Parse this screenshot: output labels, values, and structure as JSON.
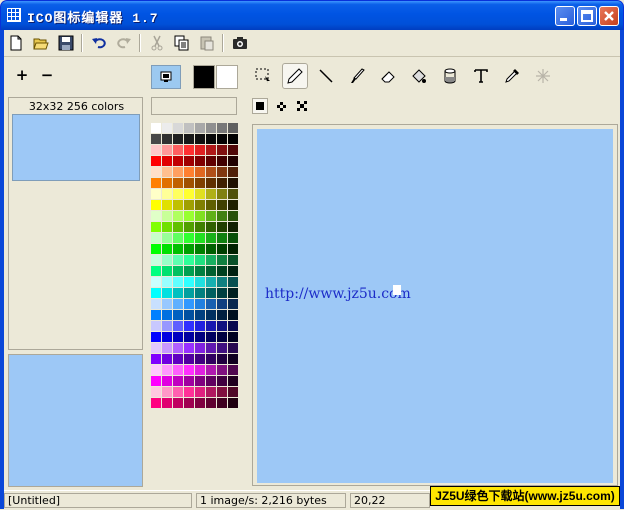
{
  "window": {
    "title": "ICO图标编辑器 1.7",
    "controls": [
      "minimize",
      "maximize",
      "close"
    ]
  },
  "toolbar": {
    "buttons": [
      "new-icon",
      "open-icon",
      "save-icon",
      "undo-icon",
      "redo-icon",
      "cut-icon",
      "copy-icon",
      "paste-icon",
      "capture-icon"
    ]
  },
  "left_panel": {
    "add_label": "+",
    "remove_label": "−",
    "image_list_label": "32x32 256 colors"
  },
  "palette": {
    "foreground_color": "#000000",
    "background_color": "#ffffff",
    "colors": [
      "#ffffff",
      "#ececec",
      "#d8d8d8",
      "#c0c0c0",
      "#a8a8a8",
      "#909090",
      "#787878",
      "#606060",
      "#484848",
      "#303030",
      "#202020",
      "#181818",
      "#101010",
      "#080808",
      "#040404",
      "#000000",
      "#ffc8c8",
      "#ff9898",
      "#ff6060",
      "#ff3030",
      "#e02020",
      "#b01818",
      "#801010",
      "#500808",
      "#ff0000",
      "#e00000",
      "#c00000",
      "#a00000",
      "#800000",
      "#600000",
      "#400000",
      "#200000",
      "#ffe0c8",
      "#ffc090",
      "#ffa060",
      "#ff8030",
      "#e06820",
      "#b05018",
      "#803810",
      "#502008",
      "#ff8000",
      "#e07000",
      "#c06000",
      "#a05000",
      "#804000",
      "#603000",
      "#402000",
      "#201000",
      "#ffffc8",
      "#ffff98",
      "#ffff60",
      "#ffff30",
      "#e0e020",
      "#b0b018",
      "#808010",
      "#505008",
      "#ffff00",
      "#e0e000",
      "#c0c000",
      "#a0a000",
      "#808000",
      "#606000",
      "#404000",
      "#202000",
      "#e0ffc8",
      "#c8ff98",
      "#b0ff60",
      "#98ff30",
      "#80e020",
      "#60b018",
      "#408010",
      "#285008",
      "#80ff00",
      "#70e000",
      "#60c000",
      "#50a000",
      "#408000",
      "#306000",
      "#204000",
      "#102000",
      "#c8ffc8",
      "#98ff98",
      "#60ff60",
      "#30ff30",
      "#20e020",
      "#18b018",
      "#108010",
      "#085008",
      "#00ff00",
      "#00e000",
      "#00c000",
      "#00a000",
      "#008000",
      "#006000",
      "#004000",
      "#002000",
      "#c8ffe0",
      "#98ffc8",
      "#60ffb0",
      "#30ff98",
      "#20e080",
      "#18b060",
      "#108040",
      "#085028",
      "#00ff80",
      "#00e070",
      "#00c060",
      "#00a050",
      "#008040",
      "#006030",
      "#004020",
      "#002010",
      "#c8ffff",
      "#98ffff",
      "#60ffff",
      "#30ffff",
      "#20e0e0",
      "#18b0b0",
      "#108080",
      "#085050",
      "#00ffff",
      "#00e0e0",
      "#00c0c0",
      "#00a0a0",
      "#008080",
      "#006060",
      "#004040",
      "#002020",
      "#c8e0ff",
      "#98c8ff",
      "#60b0ff",
      "#3098ff",
      "#2080e0",
      "#1860b0",
      "#104080",
      "#082850",
      "#0080ff",
      "#0070e0",
      "#0060c0",
      "#0050a0",
      "#004080",
      "#003060",
      "#002040",
      "#001020",
      "#c8c8ff",
      "#9898ff",
      "#6060ff",
      "#3030ff",
      "#2020e0",
      "#1818b0",
      "#101080",
      "#080850",
      "#0000ff",
      "#0000e0",
      "#0000c0",
      "#0000a0",
      "#000080",
      "#000060",
      "#000040",
      "#000020",
      "#e0c8ff",
      "#c898ff",
      "#b060ff",
      "#9830ff",
      "#8020e0",
      "#6018b0",
      "#401080",
      "#280850",
      "#8000ff",
      "#7000e0",
      "#6000c0",
      "#5000a0",
      "#400080",
      "#300060",
      "#200040",
      "#100020",
      "#ffc8ff",
      "#ff98ff",
      "#ff60ff",
      "#ff30ff",
      "#e020e0",
      "#b018b0",
      "#801080",
      "#500850",
      "#ff00ff",
      "#e000e0",
      "#c000c0",
      "#a000a0",
      "#800080",
      "#600060",
      "#400040",
      "#200020",
      "#ffc8e0",
      "#ff98c8",
      "#ff60b0",
      "#ff3098",
      "#e02080",
      "#b01860",
      "#801040",
      "#500828",
      "#ff0080",
      "#e00070",
      "#c00060",
      "#a00050",
      "#800040",
      "#600030",
      "#400020",
      "#200010"
    ]
  },
  "tools": [
    "select-icon",
    "pencil-icon",
    "line-icon",
    "brush-icon",
    "eraser-icon",
    "fill-icon",
    "cylinder-icon",
    "text-icon",
    "eyedropper-icon",
    "magic-icon"
  ],
  "brush_sizes": [
    "square",
    "cross-small",
    "cross-large"
  ],
  "canvas": {
    "background": "#9dc8f6",
    "text": "http://www.jz5u.com"
  },
  "statusbar": {
    "file": "[Untitled]",
    "info": "1 image/s: 2,216 bytes",
    "coords": "20,22"
  },
  "watermark": "JZ5U绿色下载站(www.jz5u.com)"
}
